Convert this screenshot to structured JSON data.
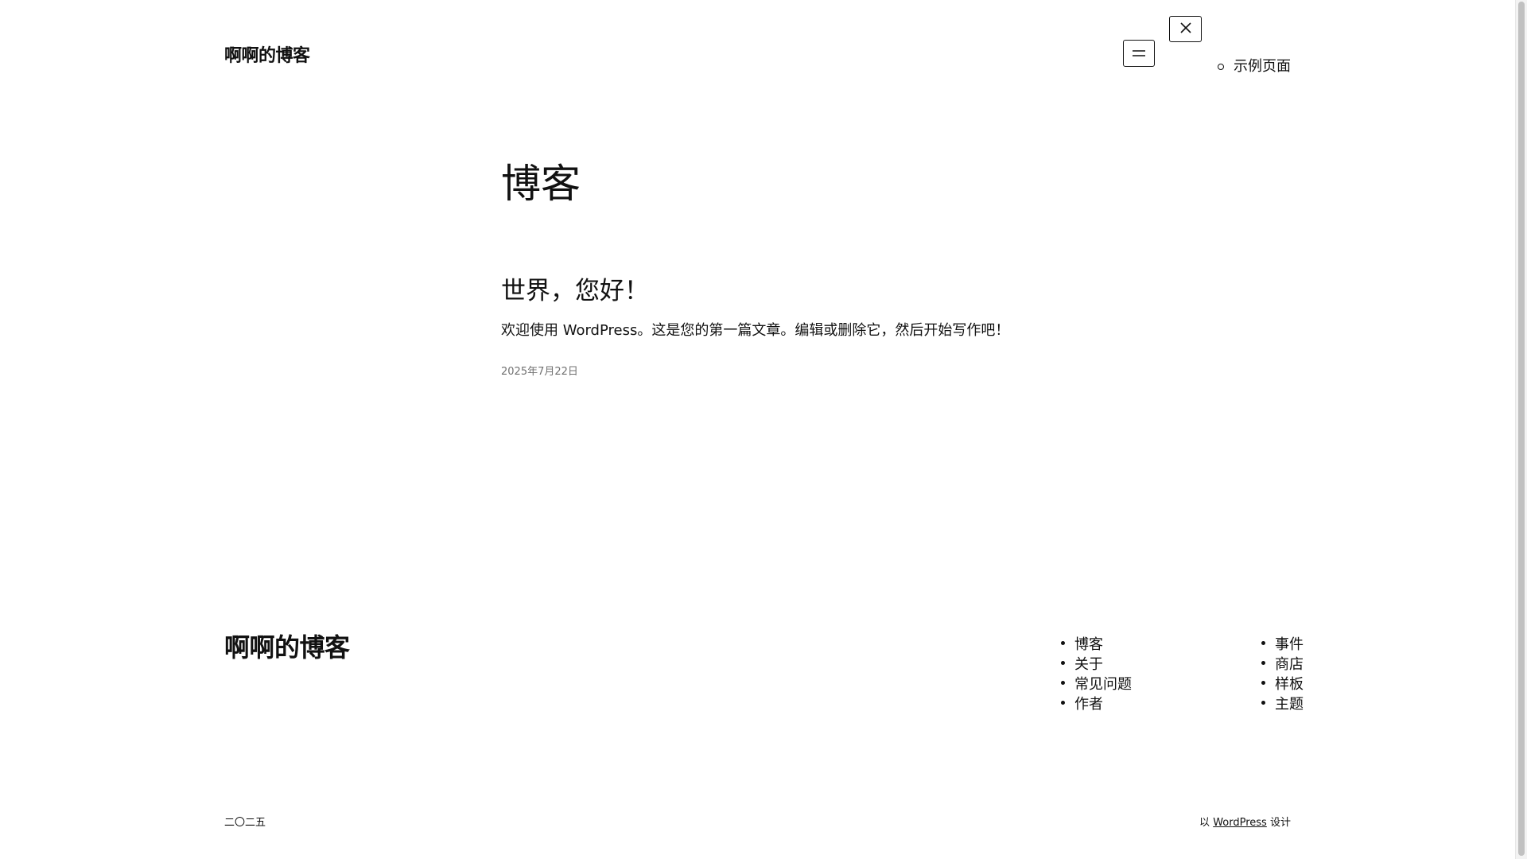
{
  "header": {
    "site_title": "啊啊的博客",
    "nav_items": [
      {
        "label": "示例页面"
      }
    ],
    "menu_icon": "menu-icon",
    "close_icon": "close-icon"
  },
  "main": {
    "heading": "博客",
    "post": {
      "title": "世界，您好！",
      "excerpt": "欢迎使用 WordPress。这是您的第一篇文章。编辑或删除它，然后开始写作吧！",
      "date": "2025年7月22日"
    }
  },
  "footer": {
    "site_title": "啊啊的博客",
    "nav_left": [
      "博客",
      "关于",
      "常见问题",
      "作者"
    ],
    "nav_right": [
      "事件",
      "商店",
      "样板",
      "主题"
    ],
    "copyright": "二〇二五",
    "credit_prefix": "以",
    "credit_link": "WordPress",
    "credit_suffix": "设计"
  },
  "colors": {
    "text": "#111111",
    "muted": "#707070",
    "background": "#ffffff"
  }
}
